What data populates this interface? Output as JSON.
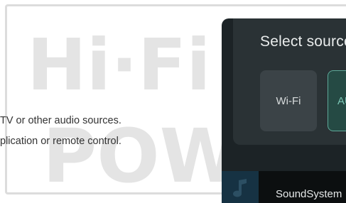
{
  "background": {
    "logo_text": {
      "line1": "Hi·Fi",
      "line2": "POW"
    },
    "text_line_1": " TV or other audio sources.",
    "text_line_2": "plication or remote control."
  },
  "panel": {
    "title": "Select source",
    "sources": [
      {
        "label": "Wi-Fi",
        "selected": false
      },
      {
        "label": "AUX",
        "selected": true
      }
    ],
    "now_playing": {
      "device": "SoundSystem"
    }
  },
  "colors": {
    "panel_bg": "#1c2326",
    "card_bg": "#2a3235",
    "accent": "#5ea999",
    "watermark": "#e4e4e4"
  },
  "icons": [
    "music-note-icon"
  ]
}
